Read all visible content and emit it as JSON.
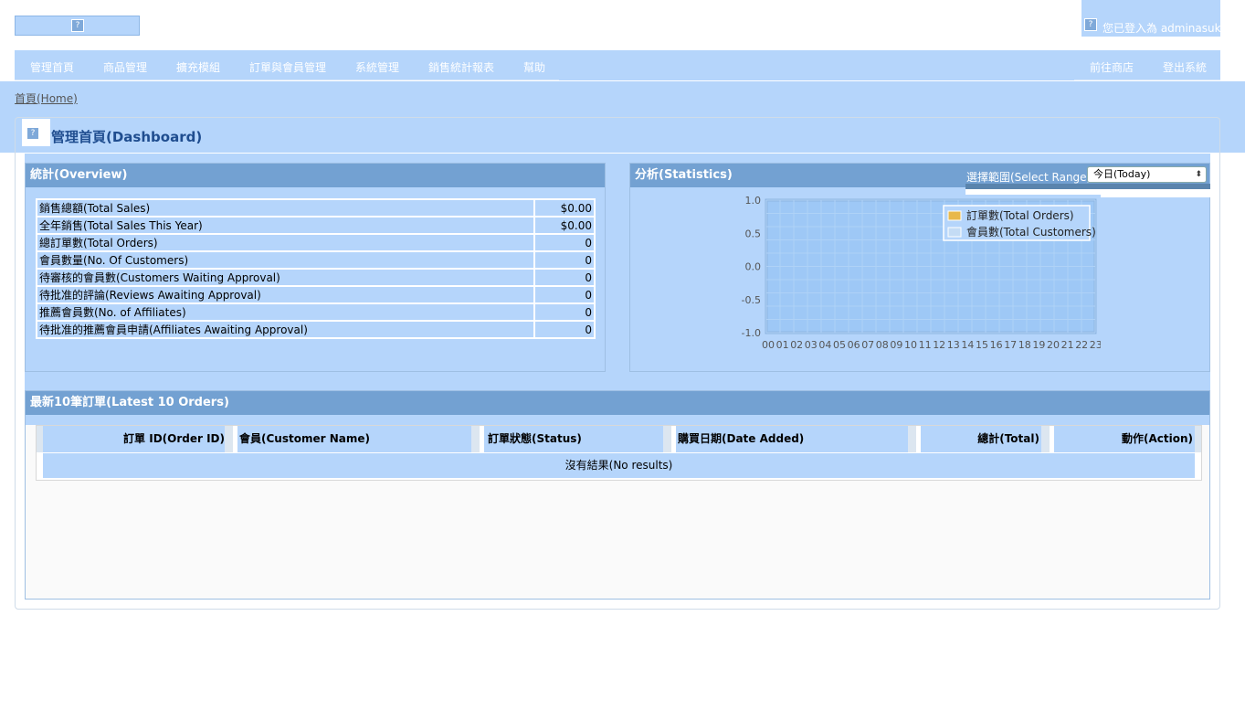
{
  "header": {
    "logo_icon": "broken-image-icon",
    "user_text": "您已登入為 adminasuka"
  },
  "menu": {
    "left": [
      "管理首頁",
      "商品管理",
      "擴充模組",
      "訂單與會員管理",
      "系統管理",
      "銷售統計報表",
      "幫助"
    ],
    "right": [
      "前往商店",
      "登出系統"
    ]
  },
  "breadcrumb": "首頁(Home)",
  "page_title": "管理首頁(Dashboard)",
  "overview": {
    "title": "統計(Overview)",
    "rows": [
      {
        "label": "銷售總額(Total Sales)",
        "value": "$0.00"
      },
      {
        "label": "全年銷售(Total Sales This Year)",
        "value": "$0.00"
      },
      {
        "label": "總訂單數(Total Orders)",
        "value": "0"
      },
      {
        "label": "會員數量(No. Of Customers)",
        "value": "0"
      },
      {
        "label": "待審核的會員數(Customers Waiting Approval)",
        "value": "0"
      },
      {
        "label": "待批准的評論(Reviews Awaiting Approval)",
        "value": "0"
      },
      {
        "label": "推薦會員數(No. of Affiliates)",
        "value": "0"
      },
      {
        "label": "待批准的推薦會員申請(Affiliates Awaiting Approval)",
        "value": "0"
      }
    ]
  },
  "statistics": {
    "title": "分析(Statistics)",
    "range_label": "選擇範圍(Select Range)",
    "range_value": "今日(Today)"
  },
  "chart_data": {
    "type": "line",
    "x": [
      "00",
      "01",
      "02",
      "03",
      "04",
      "05",
      "06",
      "07",
      "08",
      "09",
      "10",
      "11",
      "12",
      "13",
      "14",
      "15",
      "16",
      "17",
      "18",
      "19",
      "20",
      "21",
      "22",
      "23"
    ],
    "yticks": [
      "1.0",
      "0.5",
      "0.0",
      "-0.5",
      "-1.0"
    ],
    "ylim": [
      -1.0,
      1.0
    ],
    "series": [
      {
        "name": "訂單數(Total Orders)",
        "color": "#e8b84a",
        "values": []
      },
      {
        "name": "會員數(Total Customers)",
        "color": "#c4dcf5",
        "values": []
      }
    ],
    "legend": "top-right",
    "grid": true
  },
  "orders": {
    "title": "最新10筆訂單(Latest 10 Orders)",
    "columns": [
      "訂單 ID(Order ID)",
      "會員(Customer Name)",
      "訂單狀態(Status)",
      "購買日期(Date Added)",
      "總計(Total)",
      "動作(Action)"
    ],
    "empty_text": "沒有結果(No results)"
  }
}
